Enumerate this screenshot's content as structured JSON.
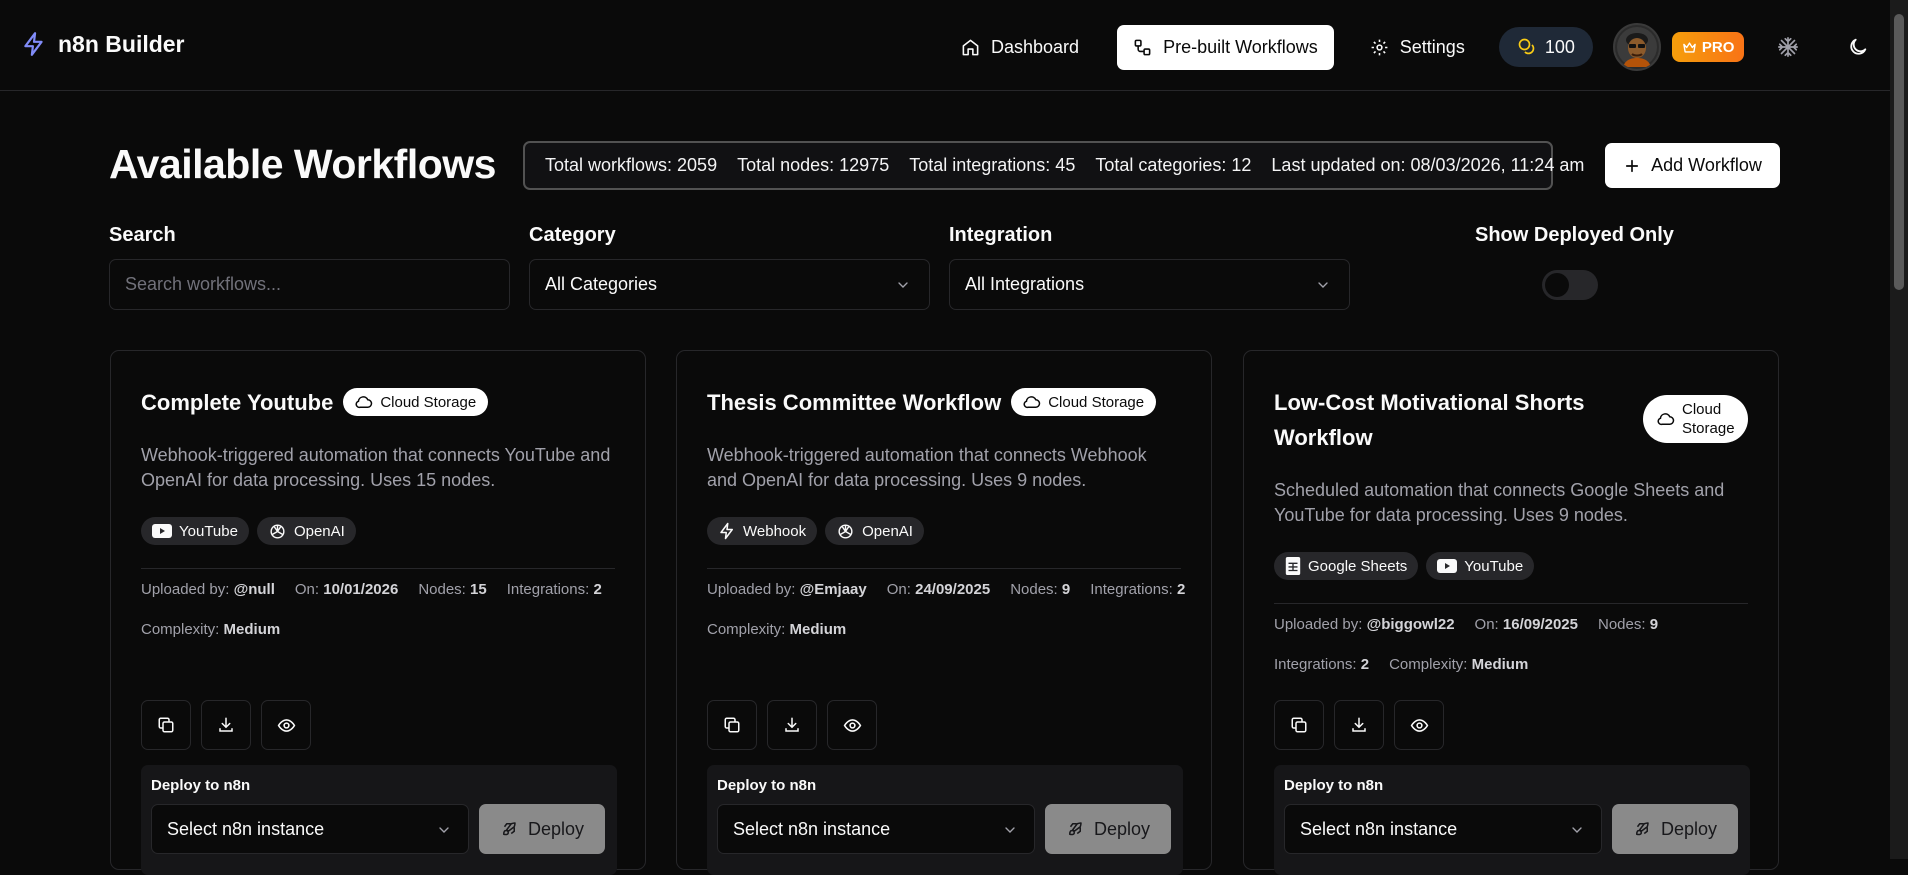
{
  "header": {
    "brand": "n8n Builder",
    "nav": [
      {
        "label": "Dashboard",
        "icon": "home-icon"
      },
      {
        "label": "Pre-built Workflows",
        "icon": "workflow-icon",
        "active": true
      },
      {
        "label": "Settings",
        "icon": "gear-icon"
      }
    ],
    "credits": "100",
    "pro_label": "PRO"
  },
  "page": {
    "title": "Available Workflows",
    "stats": [
      "Total workflows: 2059",
      "Total nodes: 12975",
      "Total integrations: 45",
      "Total categories: 12",
      "Last updated on: 08/03/2026, 11:24 am"
    ],
    "add_button": "Add Workflow"
  },
  "filters": {
    "search_label": "Search",
    "search_placeholder": "Search workflows...",
    "category_label": "Category",
    "category_value": "All Categories",
    "integration_label": "Integration",
    "integration_value": "All Integrations",
    "deployed_label": "Show Deployed Only",
    "deployed_on": false
  },
  "cards": [
    {
      "title": "Complete Youtube",
      "badge": "Cloud Storage",
      "description": "Webhook-triggered automation that connects YouTube and OpenAI for data processing. Uses 15 nodes.",
      "tags": [
        {
          "label": "YouTube",
          "icon": "youtube-icon"
        },
        {
          "label": "OpenAI",
          "icon": "openai-icon"
        }
      ],
      "uploaded_label": "Uploaded by:",
      "uploaded_by": "@null",
      "on_label": "On:",
      "date": "10/01/2026",
      "nodes_label": "Nodes:",
      "nodes": "15",
      "integrations_label": "Integrations:",
      "integrations": "2",
      "complexity_label": "Complexity:",
      "complexity": "Medium",
      "deploy_label": "Deploy to n8n",
      "select_value": "Select n8n instance",
      "deploy_button": "Deploy"
    },
    {
      "title": "Thesis Committee Workflow",
      "badge": "Cloud Storage",
      "description": "Webhook-triggered automation that connects Webhook and OpenAI for data processing. Uses 9 nodes.",
      "tags": [
        {
          "label": "Webhook",
          "icon": "webhook-icon"
        },
        {
          "label": "OpenAI",
          "icon": "openai-icon"
        }
      ],
      "uploaded_label": "Uploaded by:",
      "uploaded_by": "@Emjaay",
      "on_label": "On:",
      "date": "24/09/2025",
      "nodes_label": "Nodes:",
      "nodes": "9",
      "integrations_label": "Integrations:",
      "integrations": "2",
      "complexity_label": "Complexity:",
      "complexity": "Medium",
      "deploy_label": "Deploy to n8n",
      "select_value": "Select n8n instance",
      "deploy_button": "Deploy"
    },
    {
      "title": "Low-Cost Motivational Shorts Workflow",
      "badge": "Cloud Storage",
      "description": "Scheduled automation that connects Google Sheets and YouTube for data processing. Uses 9 nodes.",
      "tags": [
        {
          "label": "Google Sheets",
          "icon": "sheets-icon"
        },
        {
          "label": "YouTube",
          "icon": "youtube-icon"
        }
      ],
      "uploaded_label": "Uploaded by:",
      "uploaded_by": "@biggowl22",
      "on_label": "On:",
      "date": "16/09/2025",
      "nodes_label": "Nodes:",
      "nodes": "9",
      "integrations_label": "Integrations:",
      "integrations": "2",
      "complexity_label": "Complexity:",
      "complexity": "Medium",
      "deploy_label": "Deploy to n8n",
      "select_value": "Select n8n instance",
      "deploy_button": "Deploy"
    }
  ]
}
